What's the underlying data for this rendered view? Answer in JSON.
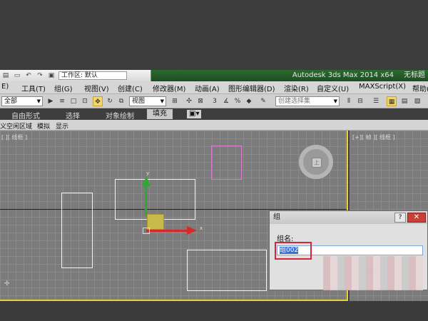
{
  "quick_access": {
    "workspace_label": "工作区: 默认"
  },
  "app_title": {
    "name": "Autodesk 3ds Max  2014 x64",
    "doc": "无标题"
  },
  "menu": [
    "E)",
    "工具(T)",
    "组(G)",
    "视图(V)",
    "创建(C)",
    "修改器(M)",
    "动画(A)",
    "图形编辑器(D)",
    "渲染(R)",
    "自定义(U)",
    "MAXScript(X)",
    "帮助("
  ],
  "toolbar": {
    "filter_value": "全部",
    "view_value": "视图",
    "selection_set_placeholder": "创建选择集"
  },
  "ribbon_tabs": [
    "自由形式",
    "选择",
    "对象绘制",
    "填充"
  ],
  "sub_ribbon": [
    "义空闲区域",
    "模拟",
    "显示"
  ],
  "viewport": {
    "left_label": "[ ][ 线框 ]",
    "right_label": "[+][ 帧 ][ 线框 ]",
    "gizmo_x": "x",
    "gizmo_y": "y"
  },
  "dialog": {
    "title": "组",
    "help": "?",
    "close": "✕",
    "field_label": "组名:",
    "field_value": "组002"
  }
}
